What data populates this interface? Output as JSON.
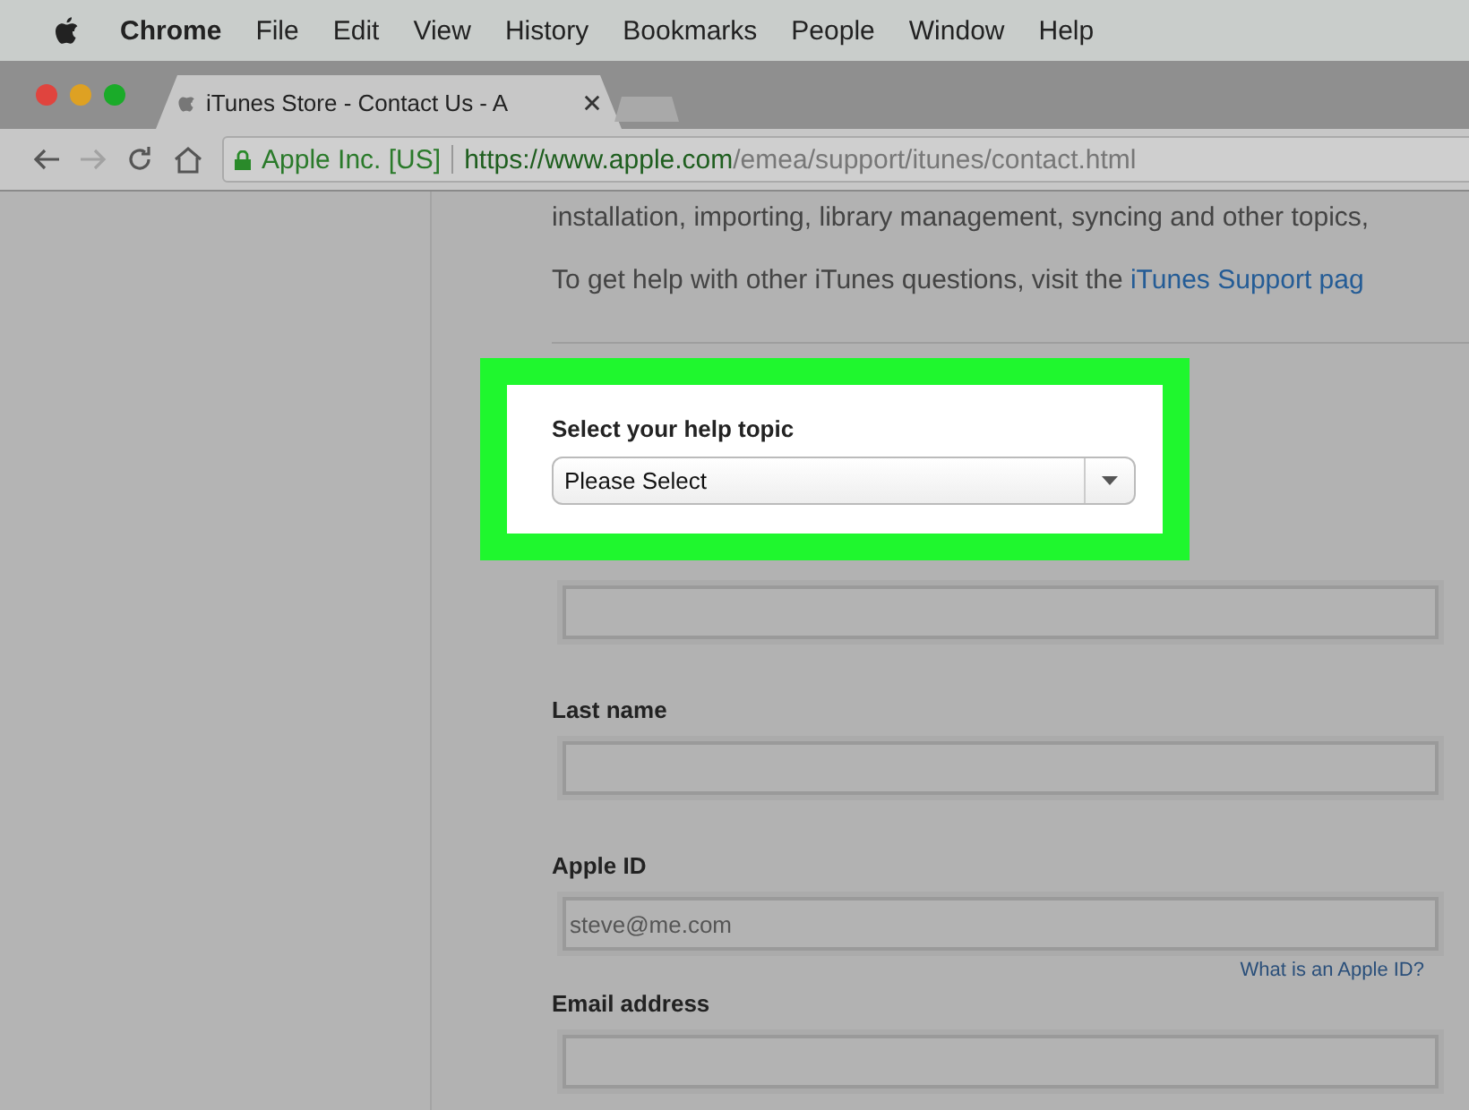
{
  "menu_bar": {
    "app": "Chrome",
    "items": [
      "File",
      "Edit",
      "View",
      "History",
      "Bookmarks",
      "People",
      "Window",
      "Help"
    ]
  },
  "tabs": [
    {
      "title": "iTunes Store - Contact Us - A",
      "selected": true
    }
  ],
  "address_bar": {
    "identity": "Apple Inc. [US]",
    "url_host": "https://www.apple.com",
    "url_path": "/emea/support/itunes/contact.html"
  },
  "intro": {
    "line": "installation, importing, library management, syncing and other topics,",
    "help_text": "To get help with other iTunes questions, visit the ",
    "help_link": "iTunes Support pag"
  },
  "highlight": {
    "label": "Select your help topic",
    "value": "Please Select"
  },
  "fields": [
    {
      "kind": "text"
    },
    {
      "kind": "text",
      "label": "Last name"
    },
    {
      "kind": "text",
      "label": "Apple ID",
      "placeholder": "steve@me.com",
      "link": "What is an Apple ID?"
    },
    {
      "kind": "text",
      "label": "Email address"
    }
  ]
}
